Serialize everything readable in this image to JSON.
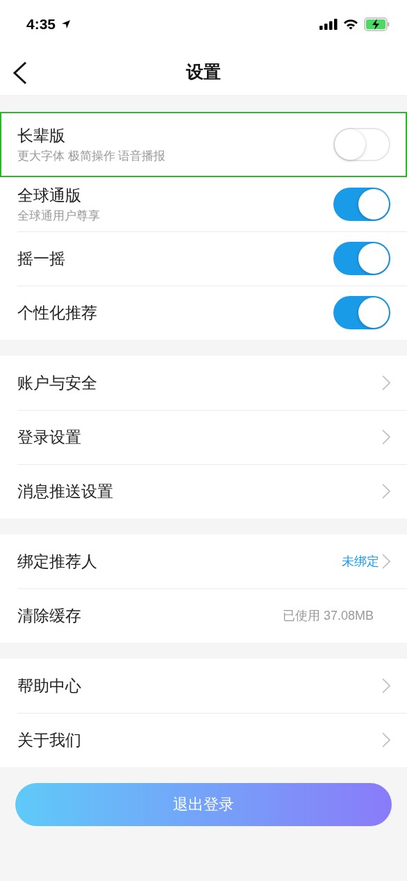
{
  "status_bar": {
    "time": "4:35"
  },
  "nav": {
    "title": "设置"
  },
  "groups": [
    {
      "rows": [
        {
          "kind": "toggle",
          "label": "长辈版",
          "subtitle": "更大字体 极简操作 语音播报",
          "on": false,
          "highlighted": true
        },
        {
          "kind": "toggle",
          "label": "全球通版",
          "subtitle": "全球通用户尊享",
          "on": true,
          "highlighted": false
        },
        {
          "kind": "toggle",
          "label": "摇一摇",
          "on": true,
          "highlighted": false
        },
        {
          "kind": "toggle",
          "label": "个性化推荐",
          "on": true,
          "highlighted": false
        }
      ]
    },
    {
      "rows": [
        {
          "kind": "link",
          "label": "账户与安全"
        },
        {
          "kind": "link",
          "label": "登录设置"
        },
        {
          "kind": "link",
          "label": "消息推送设置"
        }
      ]
    },
    {
      "rows": [
        {
          "kind": "link",
          "label": "绑定推荐人",
          "value": "未绑定"
        },
        {
          "kind": "info",
          "label": "清除缓存",
          "value": "已使用 37.08MB"
        }
      ]
    },
    {
      "rows": [
        {
          "kind": "link",
          "label": "帮助中心"
        },
        {
          "kind": "link",
          "label": "关于我们"
        }
      ]
    }
  ],
  "logout_button": "退出登录"
}
